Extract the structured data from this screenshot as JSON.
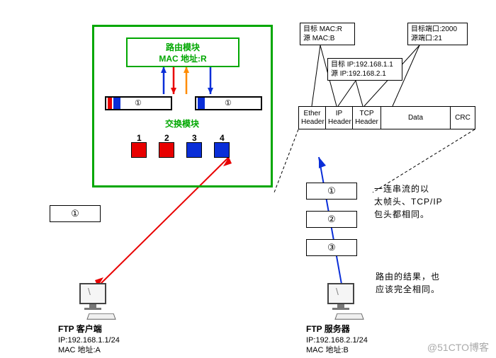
{
  "router": {
    "routing_module_l1": "路由模块",
    "routing_module_l2": "MAC 地址:R",
    "switch_module": "交换模块"
  },
  "bar_num_left": "①",
  "bar_num_right": "①",
  "ports": {
    "p1": "1",
    "p2": "2",
    "p3": "3",
    "p4": "4"
  },
  "client": {
    "title": "FTP 客户端",
    "ip": "IP:192.168.1.1/24",
    "mac": "MAC 地址:A"
  },
  "server": {
    "title": "FTP 服务器",
    "ip": "IP:192.168.2.1/24",
    "mac": "MAC 地址:B"
  },
  "packet": {
    "ether": "Ether Header",
    "ip": "IP Header",
    "tcp": "TCP Header",
    "data": "Data",
    "crc": "CRC"
  },
  "info_mac": {
    "l1": "目标 MAC:R",
    "l2": "源 MAC:B"
  },
  "info_ip": {
    "l1": "目标 IP:192.168.1.1",
    "l2": "源 IP:192.168.2.1"
  },
  "info_port": {
    "l1": "目标端口:2000",
    "l2": "源端口:21"
  },
  "seq_left": "①",
  "seq_1": "①",
  "seq_2": "②",
  "seq_3": "③",
  "explain1_l1": "一连串流的以",
  "explain1_l2": "太帧头、TCP/IP",
  "explain1_l3": "包头都相同。",
  "explain2_l1": "路由的结果，也",
  "explain2_l2": "应该完全相同。",
  "watermark": "@51CTO博客"
}
